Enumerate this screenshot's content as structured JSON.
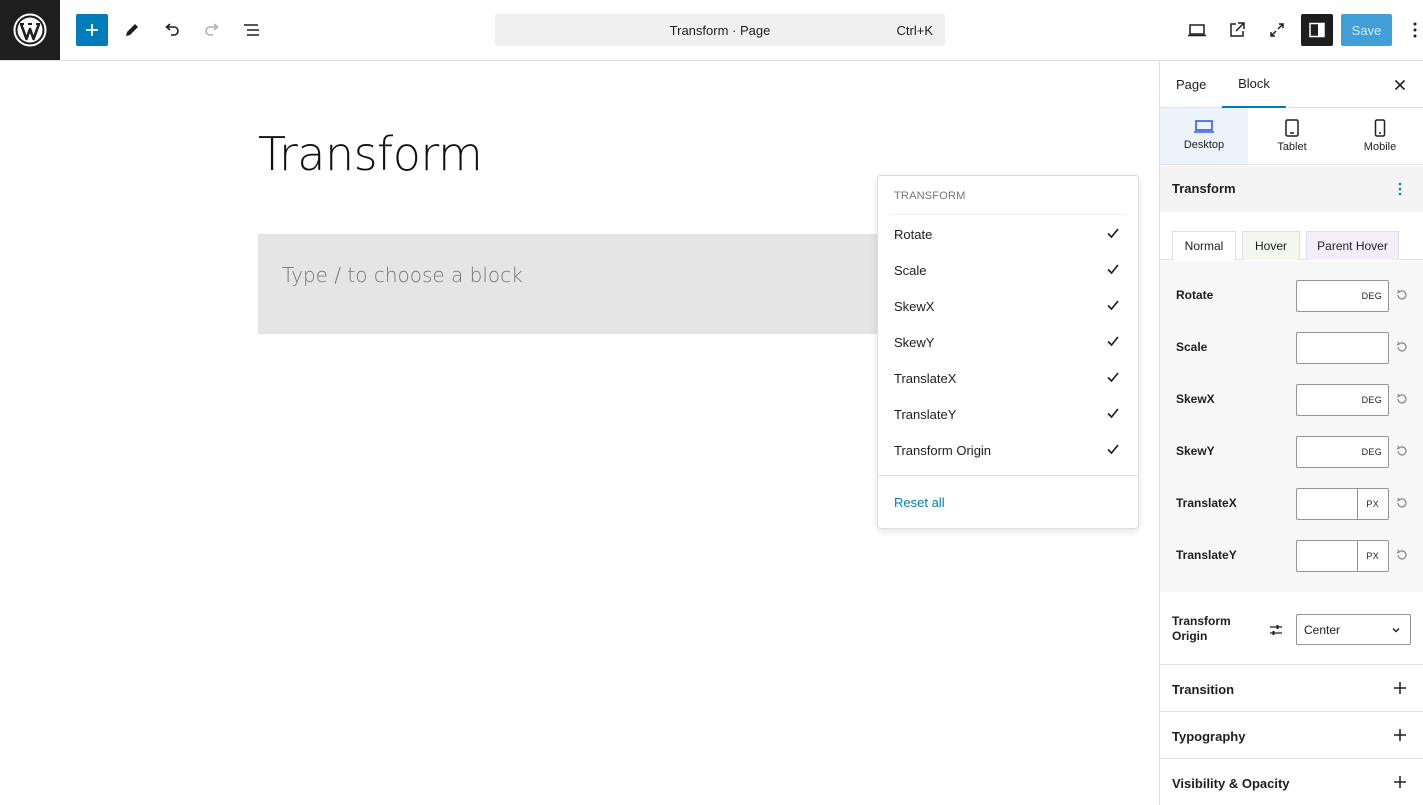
{
  "topbar": {
    "document_title": "Transform · Page",
    "shortcut": "Ctrl+K",
    "save_label": "Save"
  },
  "canvas": {
    "title": "Transform",
    "placeholder": "Type / to choose a block"
  },
  "dropdown": {
    "header": "TRANSFORM",
    "items": [
      {
        "label": "Rotate",
        "checked": true
      },
      {
        "label": "Scale",
        "checked": true
      },
      {
        "label": "SkewX",
        "checked": true
      },
      {
        "label": "SkewY",
        "checked": true
      },
      {
        "label": "TranslateX",
        "checked": true
      },
      {
        "label": "TranslateY",
        "checked": true
      },
      {
        "label": "Transform Origin",
        "checked": true
      }
    ],
    "reset_label": "Reset all"
  },
  "sidebar": {
    "tabs": {
      "page": "Page",
      "block": "Block"
    },
    "devices": [
      {
        "label": "Desktop",
        "active": true,
        "icon": "desktop-icon"
      },
      {
        "label": "Tablet",
        "active": false,
        "icon": "tablet-icon"
      },
      {
        "label": "Mobile",
        "active": false,
        "icon": "mobile-icon"
      }
    ],
    "section_title": "Transform",
    "states": {
      "normal": "Normal",
      "hover": "Hover",
      "parent_hover": "Parent Hover"
    },
    "props": [
      {
        "label": "Rotate",
        "value": "",
        "unit": "DEG"
      },
      {
        "label": "Scale",
        "value": "",
        "unit": ""
      },
      {
        "label": "SkewX",
        "value": "",
        "unit": "DEG"
      },
      {
        "label": "SkewY",
        "value": "",
        "unit": "DEG"
      },
      {
        "label": "TranslateX",
        "value": "",
        "unit": "PX"
      },
      {
        "label": "TranslateY",
        "value": "",
        "unit": "PX"
      }
    ],
    "origin": {
      "label": "Transform Origin",
      "value": "Center"
    },
    "panels": [
      {
        "label": "Transition"
      },
      {
        "label": "Typography"
      },
      {
        "label": "Visibility & Opacity"
      }
    ]
  },
  "colors": {
    "accent": "#007cba",
    "save_bg": "#3f9fd6",
    "dark": "#1e1e1e"
  }
}
